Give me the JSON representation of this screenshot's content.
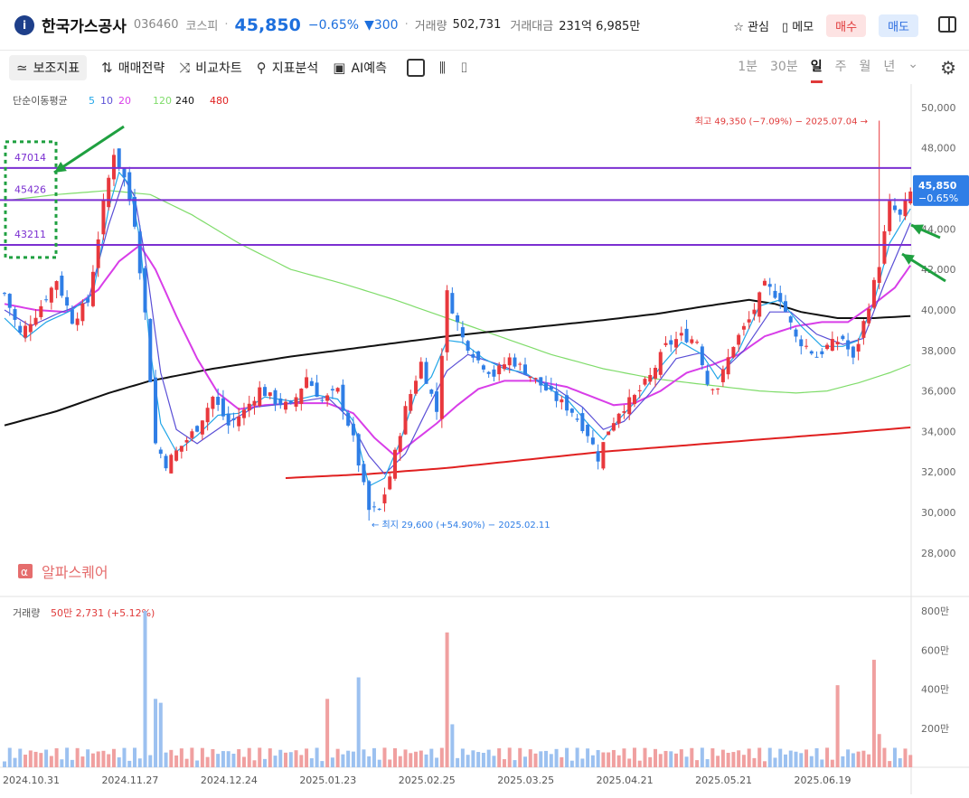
{
  "header": {
    "logo_glyph": "i",
    "stock_name": "한국가스공사",
    "code": "036460",
    "market": "코스피",
    "price": "45,850",
    "change_pct": "−0.65%",
    "change_amt": "▼300",
    "volume_label": "거래량",
    "volume": "502,731",
    "amount_label": "거래대금",
    "amount": "231억 6,985만",
    "watch_label": "관심",
    "memo_label": "메모",
    "buy_label": "매수",
    "sell_label": "매도"
  },
  "toolbar": {
    "tools": [
      "보조지표",
      "매매전략",
      "비교차트",
      "지표분석",
      "AI예측"
    ],
    "periods": [
      "1분",
      "30분",
      "일",
      "주",
      "월",
      "년"
    ],
    "selected_period": "일"
  },
  "colors": {
    "up": "#e8383d",
    "down": "#2f7ee6",
    "ma5": "#22a6e8",
    "ma10": "#5a4fd6",
    "ma20": "#d83ee8",
    "ma120": "#7fdc6a",
    "ma240": "#111111",
    "ma480": "#e02020",
    "hline": "#7b2fd1",
    "annot": "#1fa040"
  },
  "chart_data": {
    "type": "candlestick",
    "title": "",
    "legend": {
      "name": "단순이동평균",
      "periods": [
        {
          "label": "5",
          "color": "#22a6e8"
        },
        {
          "label": "10",
          "color": "#5a4fd6"
        },
        {
          "label": "20",
          "color": "#d83ee8"
        },
        {
          "label": "120",
          "color": "#7fdc6a"
        },
        {
          "label": "240",
          "color": "#111111"
        },
        {
          "label": "480",
          "color": "#e02020"
        }
      ]
    },
    "y_ticks": [
      "50,000",
      "48,000",
      "46,000",
      "44,000",
      "42,000",
      "40,000",
      "38,000",
      "36,000",
      "34,000",
      "32,000",
      "30,000",
      "28,000"
    ],
    "ylim": [
      26700,
      50800
    ],
    "x_ticks": [
      "2024.10.31",
      "2024.11.27",
      "2024.12.24",
      "2025.01.23",
      "2025.02.25",
      "2025.03.25",
      "2025.04.21",
      "2025.05.21",
      "2025.06.19"
    ],
    "x_tick_index": [
      0,
      19,
      38,
      57,
      76,
      95,
      114,
      133,
      152
    ],
    "n_bars": 175,
    "current_price": {
      "price": "45,850",
      "change": "−0.65%",
      "value": 45850
    },
    "high_annotation": {
      "text": "최고 49,350 (−7.09%) − 2025.07.04",
      "value": 49350
    },
    "low_annotation": {
      "text": "최지 29,600 (+54.90%) − 2025.02.11",
      "value": 29600
    },
    "horizontal_lines": [
      {
        "label": "47014",
        "value": 47014
      },
      {
        "label": "45426",
        "value": 45426
      },
      {
        "label": "43211",
        "value": 43211
      }
    ],
    "watermark": "알파스퀘어",
    "close_anchors": [
      [
        0,
        40800
      ],
      [
        3,
        38800
      ],
      [
        6,
        39800
      ],
      [
        10,
        41500
      ],
      [
        13,
        39500
      ],
      [
        16,
        40400
      ],
      [
        19,
        45200
      ],
      [
        21,
        47800
      ],
      [
        23,
        46500
      ],
      [
        25,
        44300
      ],
      [
        27,
        39800
      ],
      [
        29,
        33400
      ],
      [
        31,
        32400
      ],
      [
        34,
        33300
      ],
      [
        37,
        34200
      ],
      [
        40,
        35700
      ],
      [
        43,
        34300
      ],
      [
        46,
        35000
      ],
      [
        49,
        36100
      ],
      [
        52,
        35500
      ],
      [
        55,
        35200
      ],
      [
        58,
        36700
      ],
      [
        61,
        35500
      ],
      [
        64,
        36000
      ],
      [
        67,
        33600
      ],
      [
        70,
        30100
      ],
      [
        72,
        30100
      ],
      [
        74,
        31800
      ],
      [
        77,
        35100
      ],
      [
        80,
        37400
      ],
      [
        83,
        35000
      ],
      [
        85,
        40800
      ],
      [
        88,
        38600
      ],
      [
        91,
        37500
      ],
      [
        94,
        36800
      ],
      [
        97,
        37600
      ],
      [
        100,
        37000
      ],
      [
        103,
        36300
      ],
      [
        106,
        35600
      ],
      [
        109,
        35000
      ],
      [
        112,
        33900
      ],
      [
        114,
        32700
      ],
      [
        116,
        34100
      ],
      [
        118,
        35000
      ],
      [
        121,
        35700
      ],
      [
        124,
        36700
      ],
      [
        127,
        38200
      ],
      [
        130,
        38700
      ],
      [
        133,
        38500
      ],
      [
        135,
        36400
      ],
      [
        137,
        36200
      ],
      [
        140,
        38300
      ],
      [
        143,
        39500
      ],
      [
        146,
        41200
      ],
      [
        149,
        40600
      ],
      [
        152,
        38600
      ],
      [
        154,
        38200
      ],
      [
        156,
        37700
      ],
      [
        158,
        38200
      ],
      [
        161,
        38600
      ],
      [
        163,
        37500
      ],
      [
        166,
        40300
      ],
      [
        168,
        42300
      ],
      [
        170,
        45200
      ],
      [
        172,
        44600
      ],
      [
        174,
        45850
      ]
    ],
    "ma_anchors": {
      "ma5": [
        [
          0,
          39600
        ],
        [
          4,
          38600
        ],
        [
          8,
          39400
        ],
        [
          13,
          40000
        ],
        [
          17,
          40800
        ],
        [
          20,
          45000
        ],
        [
          22,
          46800
        ],
        [
          24,
          46200
        ],
        [
          26,
          43500
        ],
        [
          28,
          38000
        ],
        [
          30,
          34400
        ],
        [
          33,
          33000
        ],
        [
          37,
          33800
        ],
        [
          41,
          34800
        ],
        [
          45,
          34900
        ],
        [
          50,
          35700
        ],
        [
          55,
          35500
        ],
        [
          60,
          35800
        ],
        [
          64,
          35600
        ],
        [
          67,
          34500
        ],
        [
          70,
          31300
        ],
        [
          73,
          31700
        ],
        [
          76,
          33500
        ],
        [
          79,
          35900
        ],
        [
          82,
          36700
        ],
        [
          85,
          38500
        ],
        [
          88,
          38400
        ],
        [
          92,
          37600
        ],
        [
          96,
          37100
        ],
        [
          100,
          36900
        ],
        [
          104,
          36200
        ],
        [
          108,
          35600
        ],
        [
          112,
          34400
        ],
        [
          115,
          33600
        ],
        [
          118,
          34600
        ],
        [
          122,
          35700
        ],
        [
          126,
          37200
        ],
        [
          130,
          38400
        ],
        [
          134,
          37800
        ],
        [
          137,
          36600
        ],
        [
          141,
          38000
        ],
        [
          145,
          40200
        ],
        [
          149,
          40500
        ],
        [
          153,
          39200
        ],
        [
          157,
          38200
        ],
        [
          161,
          38200
        ],
        [
          164,
          38500
        ],
        [
          167,
          40400
        ],
        [
          170,
          43300
        ],
        [
          174,
          45000
        ]
      ],
      "ma10": [
        [
          0,
          40000
        ],
        [
          5,
          39200
        ],
        [
          10,
          39800
        ],
        [
          16,
          40400
        ],
        [
          20,
          44200
        ],
        [
          23,
          46500
        ],
        [
          25,
          45600
        ],
        [
          27,
          42600
        ],
        [
          30,
          36900
        ],
        [
          33,
          34100
        ],
        [
          37,
          33400
        ],
        [
          42,
          34300
        ],
        [
          48,
          35200
        ],
        [
          55,
          35400
        ],
        [
          62,
          35700
        ],
        [
          66,
          34700
        ],
        [
          70,
          32800
        ],
        [
          73,
          31900
        ],
        [
          77,
          32900
        ],
        [
          81,
          35000
        ],
        [
          85,
          37000
        ],
        [
          89,
          37800
        ],
        [
          95,
          37300
        ],
        [
          101,
          36700
        ],
        [
          106,
          36100
        ],
        [
          111,
          35200
        ],
        [
          115,
          34100
        ],
        [
          119,
          34500
        ],
        [
          124,
          35900
        ],
        [
          129,
          37600
        ],
        [
          134,
          37900
        ],
        [
          138,
          37000
        ],
        [
          142,
          38000
        ],
        [
          147,
          39900
        ],
        [
          151,
          39900
        ],
        [
          156,
          38800
        ],
        [
          161,
          38300
        ],
        [
          165,
          38600
        ],
        [
          169,
          41300
        ],
        [
          174,
          44300
        ]
      ],
      "ma20": [
        [
          0,
          40300
        ],
        [
          6,
          40000
        ],
        [
          12,
          39900
        ],
        [
          18,
          41000
        ],
        [
          22,
          42400
        ],
        [
          26,
          43200
        ],
        [
          29,
          42000
        ],
        [
          33,
          39700
        ],
        [
          37,
          37600
        ],
        [
          41,
          35900
        ],
        [
          45,
          35100
        ],
        [
          50,
          35300
        ],
        [
          56,
          35400
        ],
        [
          62,
          35400
        ],
        [
          67,
          34900
        ],
        [
          71,
          33700
        ],
        [
          75,
          32800
        ],
        [
          79,
          33600
        ],
        [
          83,
          34400
        ],
        [
          87,
          35300
        ],
        [
          91,
          36100
        ],
        [
          96,
          36500
        ],
        [
          102,
          36500
        ],
        [
          108,
          36200
        ],
        [
          113,
          35700
        ],
        [
          117,
          35300
        ],
        [
          121,
          35400
        ],
        [
          126,
          36000
        ],
        [
          131,
          36900
        ],
        [
          136,
          37300
        ],
        [
          141,
          37800
        ],
        [
          146,
          38700
        ],
        [
          152,
          39200
        ],
        [
          157,
          39400
        ],
        [
          162,
          39400
        ],
        [
          167,
          40300
        ],
        [
          171,
          41100
        ],
        [
          174,
          42200
        ]
      ],
      "ma120": [
        [
          0,
          45400
        ],
        [
          10,
          45700
        ],
        [
          20,
          45900
        ],
        [
          28,
          45700
        ],
        [
          36,
          44700
        ],
        [
          45,
          43300
        ],
        [
          55,
          42000
        ],
        [
          65,
          41300
        ],
        [
          75,
          40500
        ],
        [
          85,
          39600
        ],
        [
          95,
          38700
        ],
        [
          105,
          37800
        ],
        [
          115,
          37100
        ],
        [
          125,
          36600
        ],
        [
          135,
          36300
        ],
        [
          145,
          36000
        ],
        [
          152,
          35900
        ],
        [
          158,
          36000
        ],
        [
          164,
          36400
        ],
        [
          170,
          36900
        ],
        [
          174,
          37300
        ]
      ],
      "ma240": [
        [
          0,
          34300
        ],
        [
          10,
          35000
        ],
        [
          20,
          35900
        ],
        [
          28,
          36500
        ],
        [
          40,
          37100
        ],
        [
          55,
          37700
        ],
        [
          70,
          38200
        ],
        [
          85,
          38700
        ],
        [
          100,
          39100
        ],
        [
          115,
          39500
        ],
        [
          125,
          39800
        ],
        [
          135,
          40200
        ],
        [
          143,
          40500
        ],
        [
          148,
          40300
        ],
        [
          153,
          39900
        ],
        [
          160,
          39600
        ],
        [
          167,
          39600
        ],
        [
          174,
          39700
        ]
      ],
      "ma480": [
        [
          54,
          31700
        ],
        [
          70,
          31900
        ],
        [
          85,
          32200
        ],
        [
          100,
          32600
        ],
        [
          115,
          33000
        ],
        [
          130,
          33300
        ],
        [
          145,
          33600
        ],
        [
          160,
          33900
        ],
        [
          174,
          34200
        ]
      ]
    },
    "volume": {
      "title": "거래량",
      "last_label": "50만 2,731 (+5.12%)",
      "y_ticks": [
        "800만",
        "600만",
        "400만",
        "200만"
      ],
      "ylim": [
        0,
        8000000
      ],
      "spikes": [
        [
          27,
          8000000
        ],
        [
          29,
          3500000
        ],
        [
          30,
          3300000
        ],
        [
          62,
          3500000
        ],
        [
          68,
          4600000
        ],
        [
          85,
          6900000
        ],
        [
          86,
          2200000
        ],
        [
          160,
          4200000
        ],
        [
          167,
          5500000
        ],
        [
          168,
          1700000
        ]
      ]
    }
  }
}
